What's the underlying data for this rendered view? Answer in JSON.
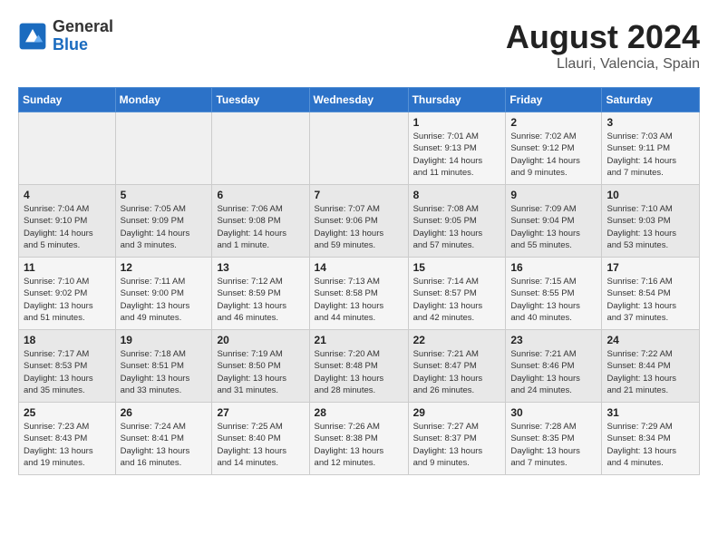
{
  "logo": {
    "general": "General",
    "blue": "Blue"
  },
  "title": "August 2024",
  "subtitle": "Llauri, Valencia, Spain",
  "days_of_week": [
    "Sunday",
    "Monday",
    "Tuesday",
    "Wednesday",
    "Thursday",
    "Friday",
    "Saturday"
  ],
  "weeks": [
    [
      {
        "num": "",
        "info": ""
      },
      {
        "num": "",
        "info": ""
      },
      {
        "num": "",
        "info": ""
      },
      {
        "num": "",
        "info": ""
      },
      {
        "num": "1",
        "info": "Sunrise: 7:01 AM\nSunset: 9:13 PM\nDaylight: 14 hours\nand 11 minutes."
      },
      {
        "num": "2",
        "info": "Sunrise: 7:02 AM\nSunset: 9:12 PM\nDaylight: 14 hours\nand 9 minutes."
      },
      {
        "num": "3",
        "info": "Sunrise: 7:03 AM\nSunset: 9:11 PM\nDaylight: 14 hours\nand 7 minutes."
      }
    ],
    [
      {
        "num": "4",
        "info": "Sunrise: 7:04 AM\nSunset: 9:10 PM\nDaylight: 14 hours\nand 5 minutes."
      },
      {
        "num": "5",
        "info": "Sunrise: 7:05 AM\nSunset: 9:09 PM\nDaylight: 14 hours\nand 3 minutes."
      },
      {
        "num": "6",
        "info": "Sunrise: 7:06 AM\nSunset: 9:08 PM\nDaylight: 14 hours\nand 1 minute."
      },
      {
        "num": "7",
        "info": "Sunrise: 7:07 AM\nSunset: 9:06 PM\nDaylight: 13 hours\nand 59 minutes."
      },
      {
        "num": "8",
        "info": "Sunrise: 7:08 AM\nSunset: 9:05 PM\nDaylight: 13 hours\nand 57 minutes."
      },
      {
        "num": "9",
        "info": "Sunrise: 7:09 AM\nSunset: 9:04 PM\nDaylight: 13 hours\nand 55 minutes."
      },
      {
        "num": "10",
        "info": "Sunrise: 7:10 AM\nSunset: 9:03 PM\nDaylight: 13 hours\nand 53 minutes."
      }
    ],
    [
      {
        "num": "11",
        "info": "Sunrise: 7:10 AM\nSunset: 9:02 PM\nDaylight: 13 hours\nand 51 minutes."
      },
      {
        "num": "12",
        "info": "Sunrise: 7:11 AM\nSunset: 9:00 PM\nDaylight: 13 hours\nand 49 minutes."
      },
      {
        "num": "13",
        "info": "Sunrise: 7:12 AM\nSunset: 8:59 PM\nDaylight: 13 hours\nand 46 minutes."
      },
      {
        "num": "14",
        "info": "Sunrise: 7:13 AM\nSunset: 8:58 PM\nDaylight: 13 hours\nand 44 minutes."
      },
      {
        "num": "15",
        "info": "Sunrise: 7:14 AM\nSunset: 8:57 PM\nDaylight: 13 hours\nand 42 minutes."
      },
      {
        "num": "16",
        "info": "Sunrise: 7:15 AM\nSunset: 8:55 PM\nDaylight: 13 hours\nand 40 minutes."
      },
      {
        "num": "17",
        "info": "Sunrise: 7:16 AM\nSunset: 8:54 PM\nDaylight: 13 hours\nand 37 minutes."
      }
    ],
    [
      {
        "num": "18",
        "info": "Sunrise: 7:17 AM\nSunset: 8:53 PM\nDaylight: 13 hours\nand 35 minutes."
      },
      {
        "num": "19",
        "info": "Sunrise: 7:18 AM\nSunset: 8:51 PM\nDaylight: 13 hours\nand 33 minutes."
      },
      {
        "num": "20",
        "info": "Sunrise: 7:19 AM\nSunset: 8:50 PM\nDaylight: 13 hours\nand 31 minutes."
      },
      {
        "num": "21",
        "info": "Sunrise: 7:20 AM\nSunset: 8:48 PM\nDaylight: 13 hours\nand 28 minutes."
      },
      {
        "num": "22",
        "info": "Sunrise: 7:21 AM\nSunset: 8:47 PM\nDaylight: 13 hours\nand 26 minutes."
      },
      {
        "num": "23",
        "info": "Sunrise: 7:21 AM\nSunset: 8:46 PM\nDaylight: 13 hours\nand 24 minutes."
      },
      {
        "num": "24",
        "info": "Sunrise: 7:22 AM\nSunset: 8:44 PM\nDaylight: 13 hours\nand 21 minutes."
      }
    ],
    [
      {
        "num": "25",
        "info": "Sunrise: 7:23 AM\nSunset: 8:43 PM\nDaylight: 13 hours\nand 19 minutes."
      },
      {
        "num": "26",
        "info": "Sunrise: 7:24 AM\nSunset: 8:41 PM\nDaylight: 13 hours\nand 16 minutes."
      },
      {
        "num": "27",
        "info": "Sunrise: 7:25 AM\nSunset: 8:40 PM\nDaylight: 13 hours\nand 14 minutes."
      },
      {
        "num": "28",
        "info": "Sunrise: 7:26 AM\nSunset: 8:38 PM\nDaylight: 13 hours\nand 12 minutes."
      },
      {
        "num": "29",
        "info": "Sunrise: 7:27 AM\nSunset: 8:37 PM\nDaylight: 13 hours\nand 9 minutes."
      },
      {
        "num": "30",
        "info": "Sunrise: 7:28 AM\nSunset: 8:35 PM\nDaylight: 13 hours\nand 7 minutes."
      },
      {
        "num": "31",
        "info": "Sunrise: 7:29 AM\nSunset: 8:34 PM\nDaylight: 13 hours\nand 4 minutes."
      }
    ]
  ]
}
